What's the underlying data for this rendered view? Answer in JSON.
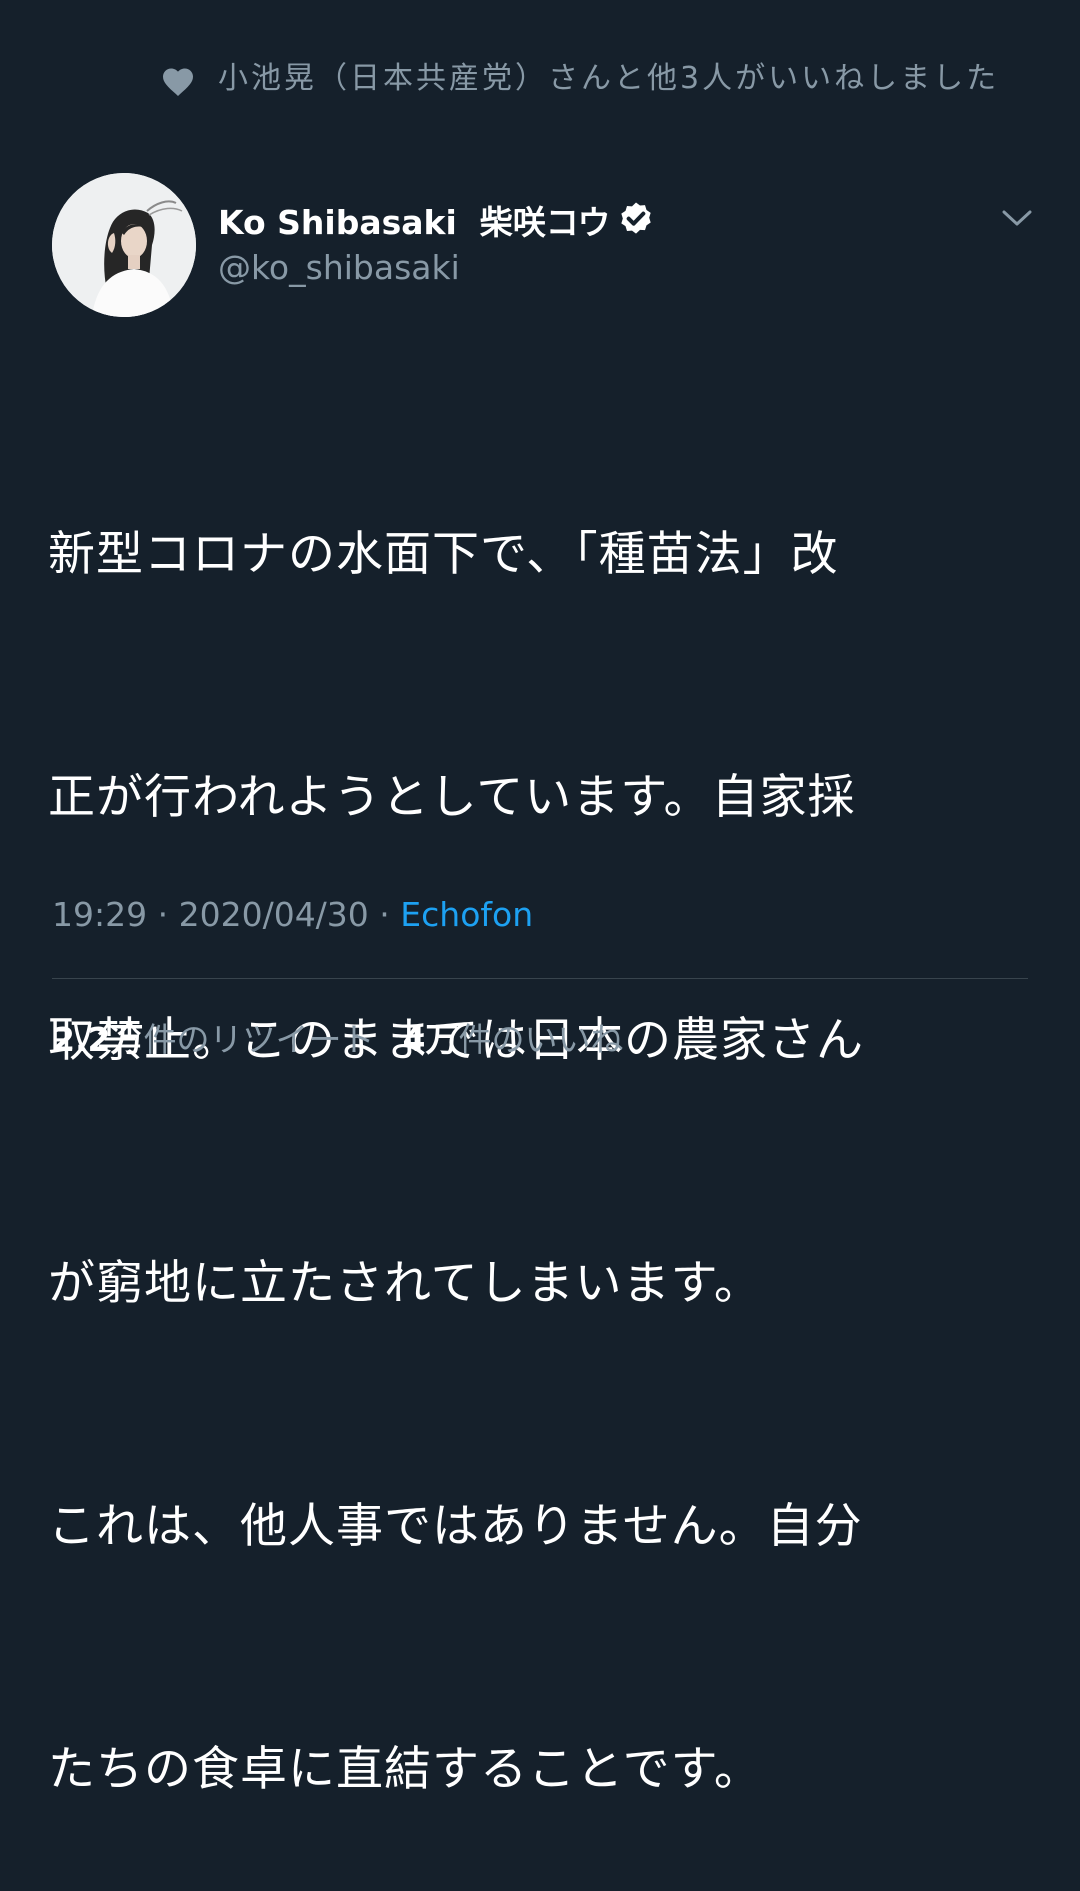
{
  "liked_by": {
    "text": "小池晃（日本共産党）さんと他3人がいいねしました",
    "icon": "heart-icon"
  },
  "author": {
    "display_name": "Ko Shibasaki  柴咲コウ",
    "handle": "@ko_shibasaki",
    "verified_icon": "verified-badge-icon",
    "menu_icon": "chevron-down-icon"
  },
  "tweet": {
    "lines": [
      "新型コロナの水面下で、「種苗法」改",
      "正が行われようとしています。自家採",
      "取禁止。このままでは日本の農家さん",
      "が窮地に立たされてしまいます。",
      "これは、他人事ではありません。自分",
      "たちの食卓に直結することです。"
    ]
  },
  "meta": {
    "time": "19:29",
    "separator": " · ",
    "date": "2020/04/30",
    "client": "Echofon"
  },
  "stats": {
    "retweets_count": "2.2万",
    "retweets_label": "件のリツイート",
    "likes_count": "4万",
    "likes_label": "件のいいね"
  },
  "colors": {
    "background": "#15202b",
    "secondary_text": "#8899a6",
    "link": "#1da1f2",
    "divider": "#38444d"
  }
}
